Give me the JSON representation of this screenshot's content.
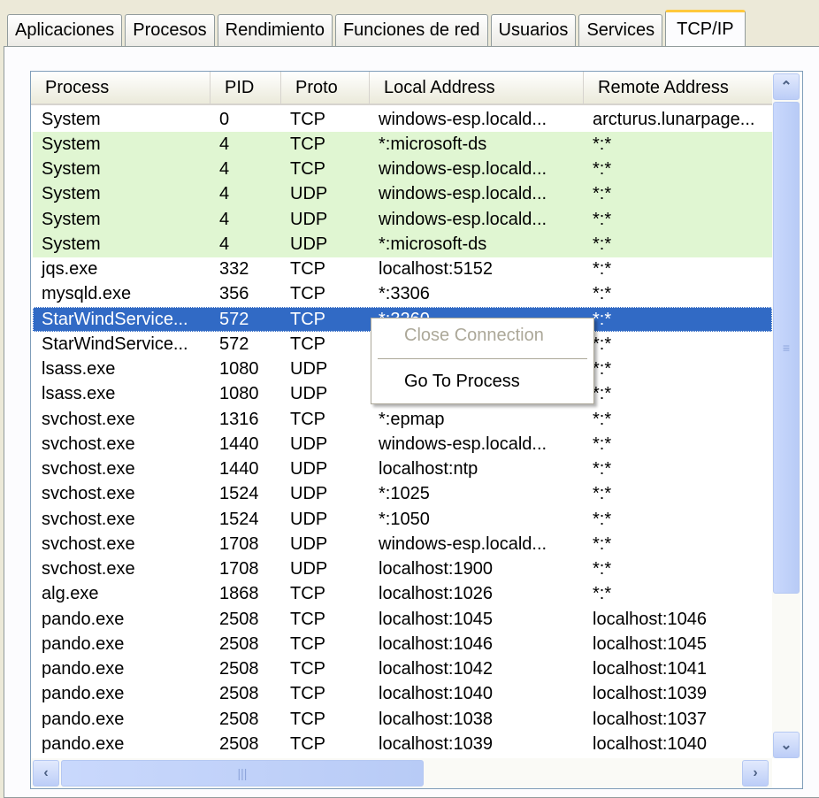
{
  "tabs": [
    "Aplicaciones",
    "Procesos",
    "Rendimiento",
    "Funciones de red",
    "Usuarios",
    "Services",
    "TCP/IP"
  ],
  "active_tab": 6,
  "columns": [
    "Process",
    "PID",
    "Proto",
    "Local Address",
    "Remote Address"
  ],
  "rows": [
    [
      "System",
      "0",
      "TCP",
      "windows-esp.locald...",
      "arcturus.lunarpage..."
    ],
    [
      "System",
      "4",
      "TCP",
      "*:microsoft-ds",
      "*:*"
    ],
    [
      "System",
      "4",
      "TCP",
      "windows-esp.locald...",
      "*:*"
    ],
    [
      "System",
      "4",
      "UDP",
      "windows-esp.locald...",
      "*:*"
    ],
    [
      "System",
      "4",
      "UDP",
      "windows-esp.locald...",
      "*:*"
    ],
    [
      "System",
      "4",
      "UDP",
      "*:microsoft-ds",
      "*:*"
    ],
    [
      "jqs.exe",
      "332",
      "TCP",
      "localhost:5152",
      "*:*"
    ],
    [
      "mysqld.exe",
      "356",
      "TCP",
      "*:3306",
      "*:*"
    ],
    [
      "StarWindService...",
      "572",
      "TCP",
      "*:3260",
      "*:*"
    ],
    [
      "StarWindService...",
      "572",
      "TCP",
      "",
      "*:*"
    ],
    [
      "lsass.exe",
      "1080",
      "UDP",
      "",
      "*:*"
    ],
    [
      "lsass.exe",
      "1080",
      "UDP",
      "",
      "*:*"
    ],
    [
      "svchost.exe",
      "1316",
      "TCP",
      "*:epmap",
      "*:*"
    ],
    [
      "svchost.exe",
      "1440",
      "UDP",
      "windows-esp.locald...",
      "*:*"
    ],
    [
      "svchost.exe",
      "1440",
      "UDP",
      "localhost:ntp",
      "*:*"
    ],
    [
      "svchost.exe",
      "1524",
      "UDP",
      "*:1025",
      "*:*"
    ],
    [
      "svchost.exe",
      "1524",
      "UDP",
      "*:1050",
      "*:*"
    ],
    [
      "svchost.exe",
      "1708",
      "UDP",
      "windows-esp.locald...",
      "*:*"
    ],
    [
      "svchost.exe",
      "1708",
      "UDP",
      "localhost:1900",
      "*:*"
    ],
    [
      "alg.exe",
      "1868",
      "TCP",
      "localhost:1026",
      "*:*"
    ],
    [
      "pando.exe",
      "2508",
      "TCP",
      "localhost:1045",
      "localhost:1046"
    ],
    [
      "pando.exe",
      "2508",
      "TCP",
      "localhost:1046",
      "localhost:1045"
    ],
    [
      "pando.exe",
      "2508",
      "TCP",
      "localhost:1042",
      "localhost:1041"
    ],
    [
      "pando.exe",
      "2508",
      "TCP",
      "localhost:1040",
      "localhost:1039"
    ],
    [
      "pando.exe",
      "2508",
      "TCP",
      "localhost:1038",
      "localhost:1037"
    ],
    [
      "pando.exe",
      "2508",
      "TCP",
      "localhost:1039",
      "localhost:1040"
    ]
  ],
  "highlighted_rows": [
    1,
    2,
    3,
    4,
    5
  ],
  "selected_row": 8,
  "colors": {
    "highlight": "#e0f6d2",
    "selected": "#316ac5"
  },
  "context_menu": {
    "close_connection": "Close Connection",
    "go_to_process": "Go To Process",
    "close_enabled": false
  }
}
